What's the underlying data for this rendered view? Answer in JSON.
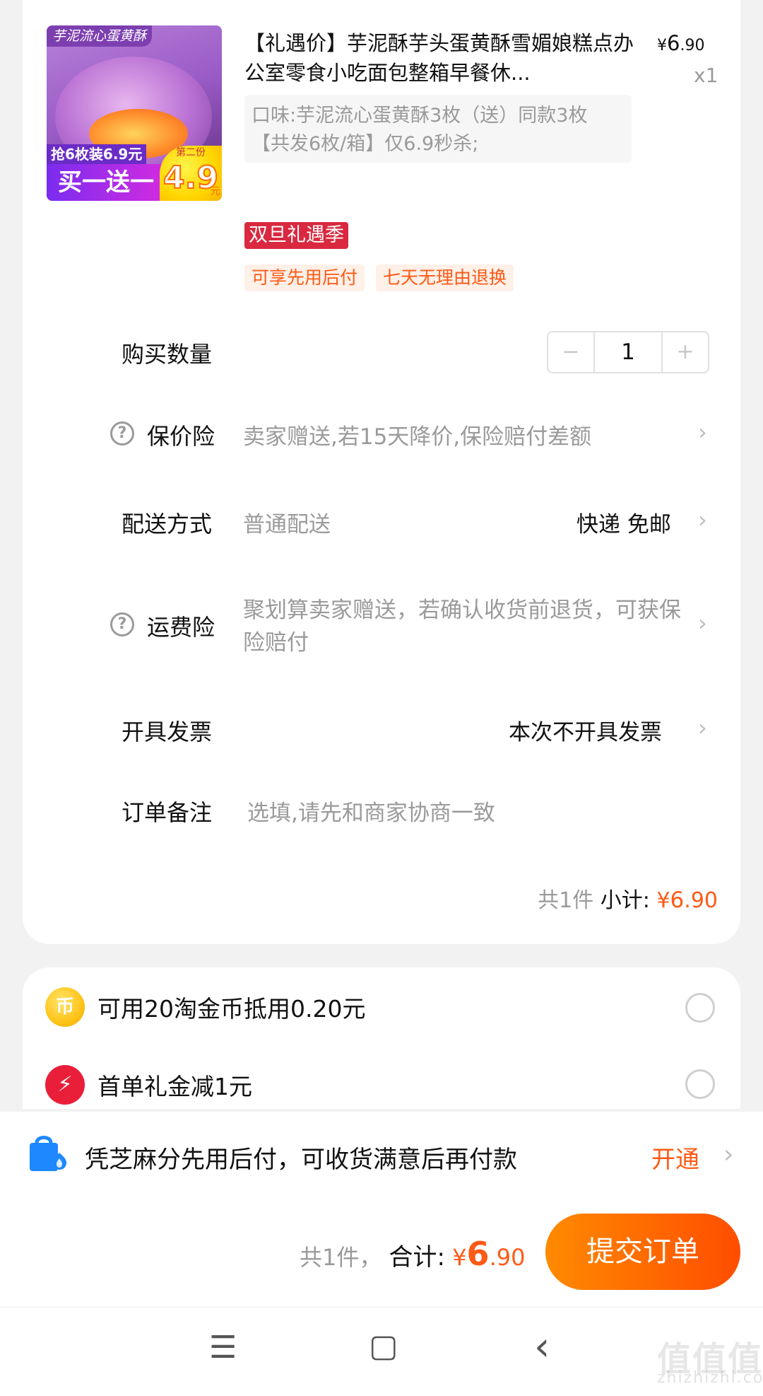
{
  "product": {
    "title": "【礼遇价】芋泥酥芋头蛋黄酥雪媚娘糕点办公室零食小吃面包整箱早餐休...",
    "price_symbol": "¥",
    "price_int": "6",
    "price_dec": ".90",
    "quantity_text": "x1",
    "spec": "口味:芋泥流心蛋黄酥3枚（送）同款3枚【共发6枚/箱】仅6.9秒杀;",
    "image": {
      "top_label": "芋泥流心蛋黄酥",
      "promo_small": "抢6枚装6.9元",
      "promo_big": "买一送一",
      "badge_small": "第二份",
      "badge_price": "4.9",
      "badge_unit": "元"
    },
    "promo_tag": "双旦礼遇季",
    "service_tags": [
      "可享先用后付",
      "七天无理由退换"
    ]
  },
  "order_rows": {
    "quantity": {
      "label": "购买数量",
      "value": "1",
      "minus": "−",
      "plus": "+"
    },
    "price_protection": {
      "label": "保价险",
      "desc": "卖家赠送,若15天降价,保险赔付差额"
    },
    "delivery": {
      "label": "配送方式",
      "desc": "普通配送",
      "value": "快递 免邮"
    },
    "shipping_insurance": {
      "label": "运费险",
      "desc": "聚划算卖家赠送，若确认收货前退货，可获保险赔付"
    },
    "invoice": {
      "label": "开具发票",
      "value": "本次不开具发票"
    },
    "note": {
      "label": "订单备注",
      "placeholder": "选填,请先和商家协商一致"
    }
  },
  "subtotal": {
    "count": "共1件",
    "label": "小计:",
    "symbol": "¥",
    "int": "6",
    "dec": ".90"
  },
  "discounts": [
    {
      "icon_text": "币",
      "label": "可用20淘金币抵用0.20元"
    },
    {
      "icon_text": "⚡",
      "label": "首单礼金减1元"
    }
  ],
  "pay_later": {
    "text": "凭芝麻分先用后付，可收货满意后再付款",
    "action": "开通"
  },
  "total": {
    "count": "共1件，",
    "label": "合计:",
    "symbol": "¥",
    "int": "6",
    "dec": ".90"
  },
  "submit_label": "提交订单",
  "nav": {
    "menu_icon": "☰",
    "home_icon": "▢",
    "back_icon": "‹"
  },
  "watermark": {
    "line1": "值值值",
    "line2": "zhizhizhi.com"
  },
  "colors": {
    "accent": "#ff5a16",
    "promo_red": "#d9283f",
    "submit_start": "#ff8a00",
    "submit_end": "#ff4d00"
  }
}
